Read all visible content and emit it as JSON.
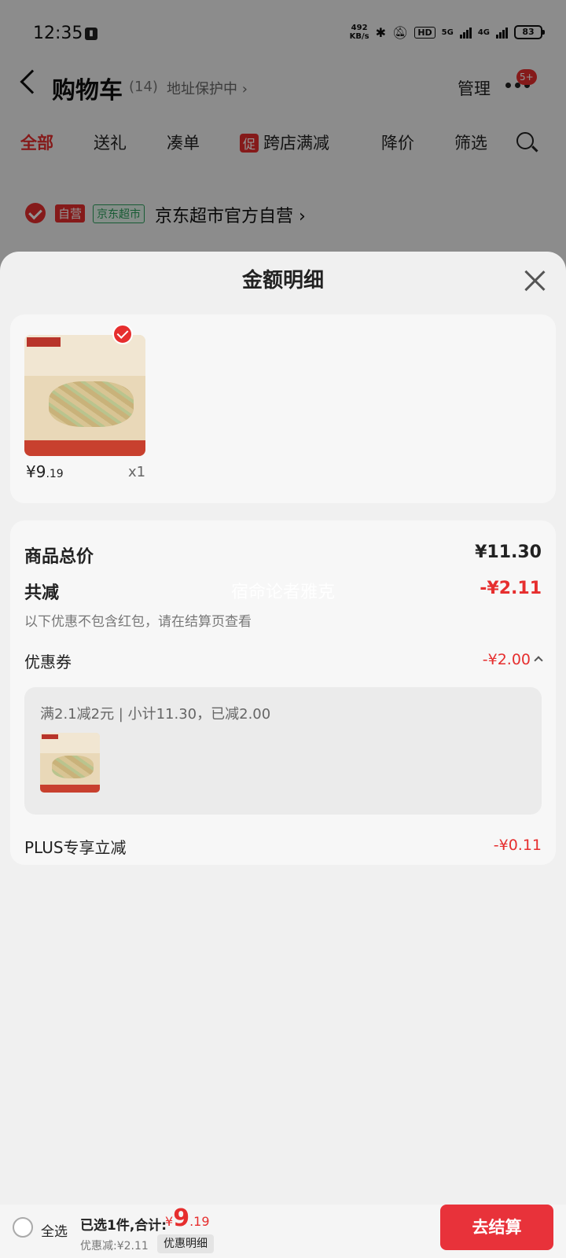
{
  "status_bar": {
    "time": "12:35",
    "net_speed": "492\nKB/s",
    "hd_label": "HD",
    "net_5g": "5G",
    "net_4g": "4G",
    "battery": "83"
  },
  "header": {
    "title": "购物车",
    "count": "(14)",
    "address_status": "地址保护中 ›",
    "manage_label": "管理",
    "more_badge": "5+"
  },
  "filter_tabs": [
    {
      "label": "全部",
      "active": true
    },
    {
      "label": "送礼",
      "active": false
    },
    {
      "label": "凑单",
      "active": false
    },
    {
      "label": "跨店满减",
      "active": false,
      "tag": "促"
    },
    {
      "label": "降价",
      "active": false
    },
    {
      "label": "筛选",
      "active": false
    }
  ],
  "shop": {
    "self_tag": "自营",
    "market_tag": "京东超市",
    "name": "京东超市官方自营 ›"
  },
  "sheet": {
    "title": "金额明细",
    "goods": {
      "price_int": "¥9",
      "price_dec": ".19",
      "quantity": "x1"
    },
    "total_price_label": "商品总价",
    "total_price_value": "¥11.30",
    "total_discount_label": "共减",
    "total_discount_value": "-¥2.11",
    "note": "以下优惠不包含红包，请在结算页查看",
    "coupon_label": "优惠券",
    "coupon_value": "-¥2.00",
    "coupon_desc": "满2.1减2元 | 小计11.30，已减2.00",
    "plus_label": "PLUS专享立减",
    "plus_value": "-¥0.11"
  },
  "watermark": "宿命论者雅克",
  "bottom_bar": {
    "select_all_label": "全选",
    "total_label": "已选1件,合计:",
    "total_yen": "¥",
    "total_int": "9",
    "total_dec": ".19",
    "discount_text": "优惠减:¥2.11",
    "detail_button": "优惠明细",
    "checkout_button": "去结算"
  },
  "colors": {
    "accent": "#e62e2e",
    "checkout": "#e8323a"
  }
}
